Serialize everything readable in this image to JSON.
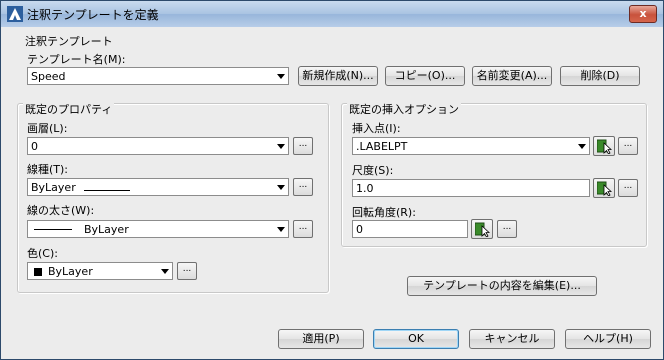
{
  "window": {
    "title": "注釈テンプレートを定義",
    "close_label": "x"
  },
  "template": {
    "group_label": "注釈テンプレート",
    "name_label": "テンプレート名(M):",
    "name_value": "Speed",
    "buttons": [
      "新規作成(N)...",
      "コピー(O)...",
      "名前変更(A)...",
      "削除(D)"
    ]
  },
  "props": {
    "group_label": "既定のプロパティ",
    "layer_label": "画層(L):",
    "layer_value": "0",
    "linetype_label": "線種(T):",
    "linetype_value": "ByLayer",
    "lineweight_label": "線の太さ(W):",
    "lineweight_value": "ByLayer",
    "color_label": "色(C):",
    "color_value": "ByLayer",
    "browse": "..."
  },
  "insert": {
    "group_label": "既定の挿入オプション",
    "point_label": "挿入点(I):",
    "point_value": ".LABELPT",
    "scale_label": "尺度(S):",
    "scale_value": "1.0",
    "rotation_label": "回転角度(R):",
    "rotation_value": "0",
    "browse": "..."
  },
  "edit_button": "テンプレートの内容を編集(E)...",
  "footer": {
    "apply": "適用(P)",
    "ok": "OK",
    "cancel": "キャンセル",
    "help": "ヘルプ(H)"
  },
  "colors": {
    "title_gradient": "#a9c3e2",
    "close": "#c8523c",
    "pick_green": "#3a8a2a"
  }
}
